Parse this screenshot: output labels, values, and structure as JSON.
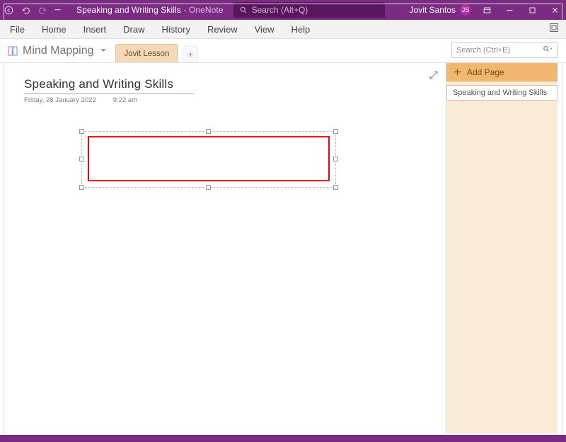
{
  "titlebar": {
    "title_doc": "Speaking and Writing Skills",
    "title_sep": "  -  ",
    "title_app": "OneNote",
    "search_placeholder": "Search (Alt+Q)",
    "user_name": "Jovit Santos",
    "user_initials": "JS"
  },
  "ribbon": {
    "items": [
      "File",
      "Home",
      "Insert",
      "Draw",
      "History",
      "Review",
      "View",
      "Help"
    ]
  },
  "notebook": {
    "name": "Mind Mapping",
    "section_tab": "Jovit Lesson",
    "page_search_placeholder": "Search (Ctrl+E)"
  },
  "page": {
    "title": "Speaking and Writing Skills",
    "date": "Friday, 28 January 2022",
    "time": "9:22 am"
  },
  "pagepane": {
    "add_label": "Add Page",
    "pages": [
      "Speaking and Writing Skills"
    ]
  }
}
